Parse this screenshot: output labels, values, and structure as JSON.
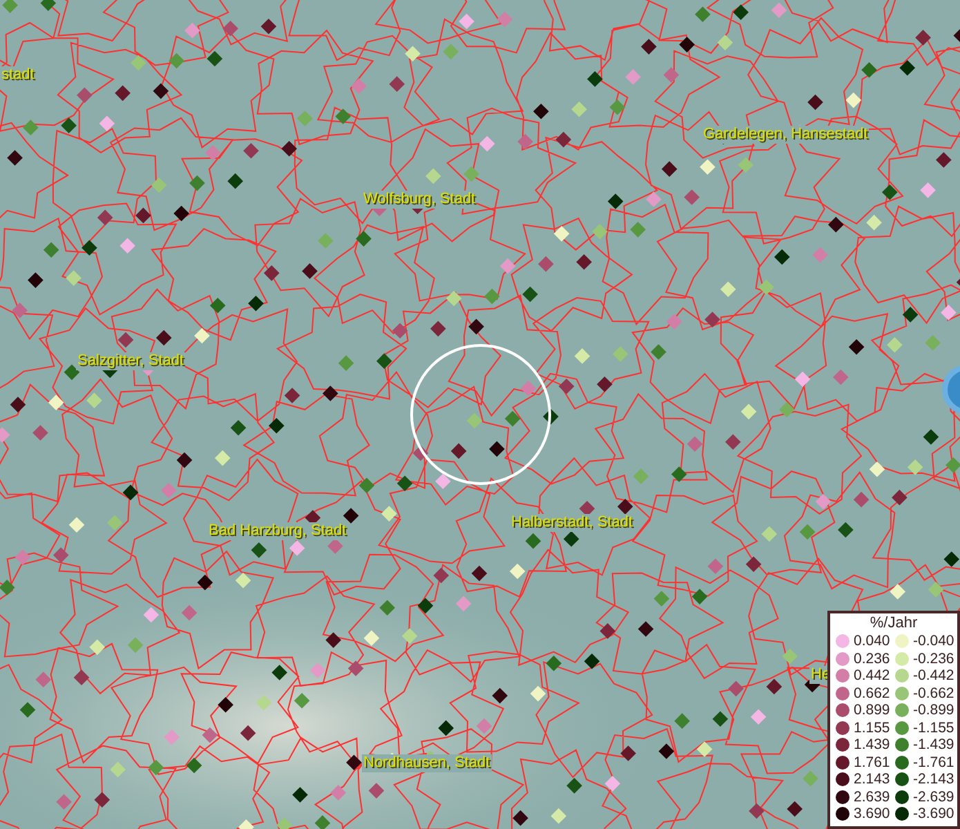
{
  "map": {
    "labels": [
      {
        "text": "stadt"
      },
      {
        "text": "Gardelegen, Hansestadt"
      },
      {
        "text": "Wolfsburg, Stadt"
      },
      {
        "text": "Salzgitter, Stadt"
      },
      {
        "text": "Bad Harzburg, Stadt"
      },
      {
        "text": "Halberstadt, Stadt"
      },
      {
        "text": "He"
      },
      {
        "text": "Nordhausen, Stadt"
      }
    ]
  },
  "legend": {
    "title": "%/Jahr",
    "positive": [
      {
        "value": "0.040",
        "color": "#f4b6e4"
      },
      {
        "value": "0.236",
        "color": "#e39ac6"
      },
      {
        "value": "0.442",
        "color": "#d27ea6"
      },
      {
        "value": "0.662",
        "color": "#c0668a"
      },
      {
        "value": "0.899",
        "color": "#aa4c6c"
      },
      {
        "value": "1.155",
        "color": "#923852"
      },
      {
        "value": "1.439",
        "color": "#7c263c"
      },
      {
        "value": "1.761",
        "color": "#64182a"
      },
      {
        "value": "2.143",
        "color": "#4a0e1a"
      },
      {
        "value": "2.639",
        "color": "#320810"
      },
      {
        "value": "3.690",
        "color": "#220408"
      }
    ],
    "negative": [
      {
        "value": "-0.040",
        "color": "#f0f4c2"
      },
      {
        "value": "-0.236",
        "color": "#d6eaa8"
      },
      {
        "value": "-0.442",
        "color": "#b6d88e"
      },
      {
        "value": "-0.662",
        "color": "#98c676"
      },
      {
        "value": "-0.899",
        "color": "#78b05c"
      },
      {
        "value": "-1.155",
        "color": "#589840"
      },
      {
        "value": "-1.439",
        "color": "#3e802e"
      },
      {
        "value": "-1.761",
        "color": "#286a1e"
      },
      {
        "value": "-2.143",
        "color": "#185214"
      },
      {
        "value": "-2.639",
        "color": "#0c3c0c"
      },
      {
        "value": "-3.690",
        "color": "#062a06"
      }
    ]
  }
}
